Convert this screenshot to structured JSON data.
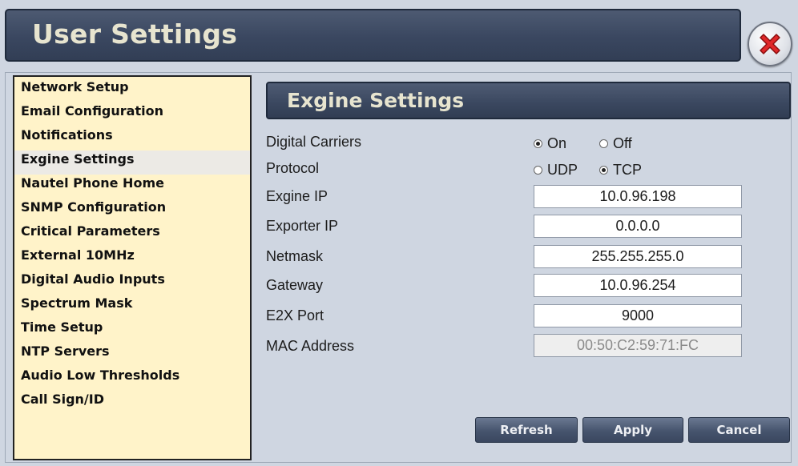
{
  "window": {
    "title": "User Settings"
  },
  "sidebar": {
    "items": [
      {
        "label": "Network Setup"
      },
      {
        "label": "Email Configuration"
      },
      {
        "label": "Notifications"
      },
      {
        "label": "Exgine Settings",
        "active": true
      },
      {
        "label": "Nautel Phone Home"
      },
      {
        "label": "SNMP Configuration"
      },
      {
        "label": "Critical Parameters"
      },
      {
        "label": "External 10MHz"
      },
      {
        "label": "Digital Audio Inputs"
      },
      {
        "label": "Spectrum Mask"
      },
      {
        "label": "Time Setup"
      },
      {
        "label": "NTP Servers"
      },
      {
        "label": "Audio Low Thresholds"
      },
      {
        "label": "Call Sign/ID"
      }
    ]
  },
  "panel": {
    "title": "Exgine Settings",
    "digital_carriers": {
      "label": "Digital Carriers",
      "options": [
        {
          "label": "On",
          "checked": true
        },
        {
          "label": "Off",
          "checked": false
        }
      ]
    },
    "protocol": {
      "label": "Protocol",
      "options": [
        {
          "label": "UDP",
          "checked": false
        },
        {
          "label": "TCP",
          "checked": true
        }
      ]
    },
    "fields": [
      {
        "label": "Exgine IP",
        "value": "10.0.96.198"
      },
      {
        "label": "Exporter IP",
        "value": "0.0.0.0"
      },
      {
        "label": "Netmask",
        "value": "255.255.255.0"
      },
      {
        "label": "Gateway",
        "value": "10.0.96.254"
      },
      {
        "label": "E2X Port",
        "value": "9000"
      },
      {
        "label": "MAC Address",
        "value": "00:50:C2:59:71:FC",
        "readonly": true
      }
    ],
    "buttons": {
      "refresh": "Refresh",
      "apply": "Apply",
      "cancel": "Cancel"
    }
  },
  "icons": {
    "close": "close-icon"
  },
  "colors": {
    "title_bar": "#3a4760",
    "title_text": "#e7e4cf",
    "sidebar_bg": "#fff3c9",
    "close_red": "#e0282a"
  }
}
